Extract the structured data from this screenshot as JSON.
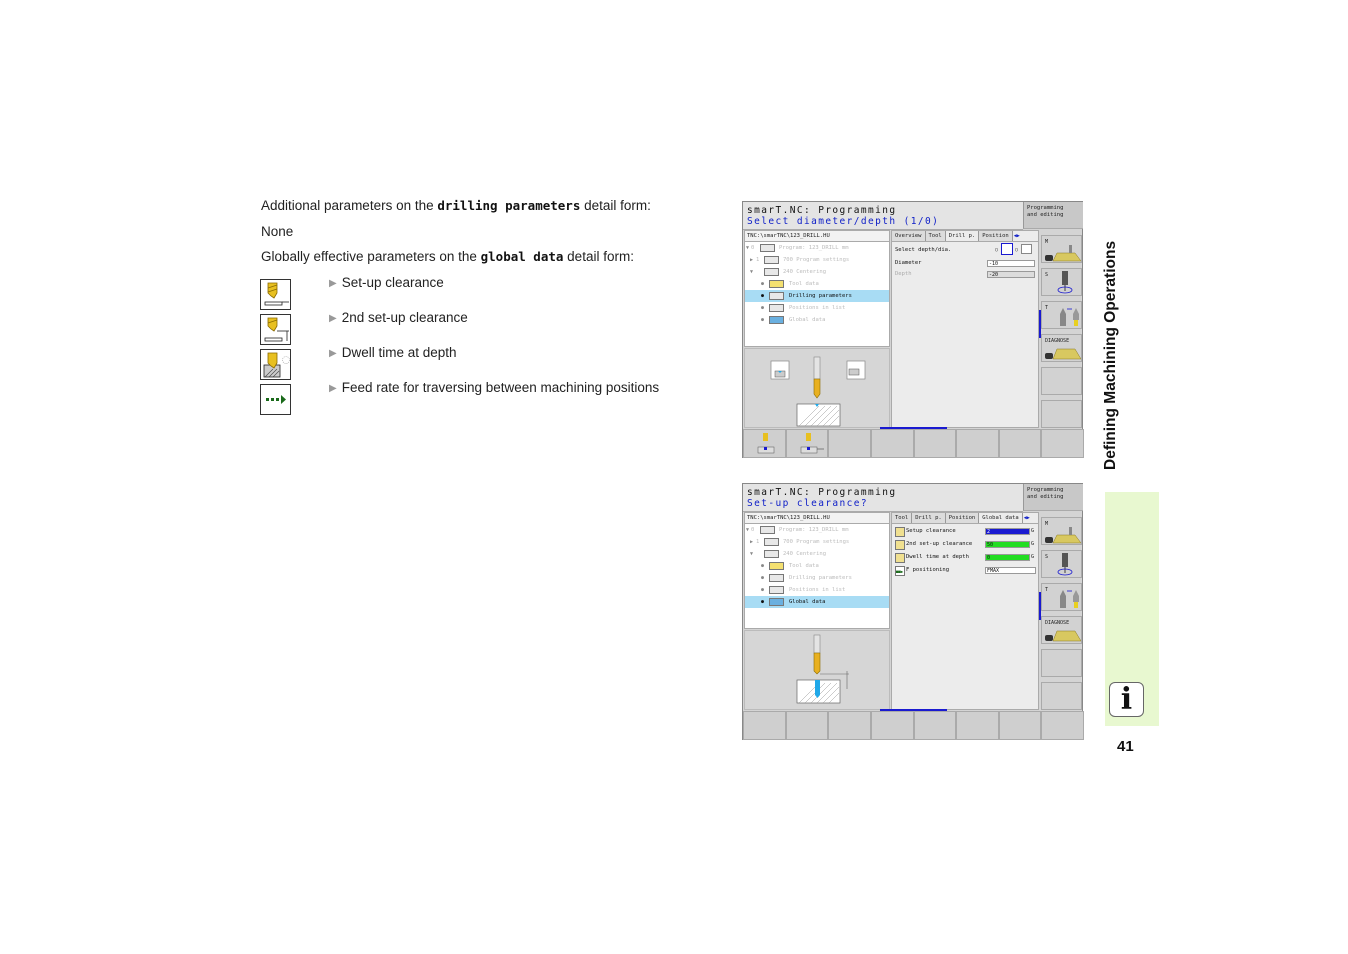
{
  "text": {
    "drilling_intro_before": "Additional parameters on the ",
    "drilling_intro_code": "drilling parameters",
    "drilling_intro_after": " detail form:",
    "none": "None",
    "global_intro_before": "Globally effective parameters on the ",
    "global_intro_code": "global data",
    "global_intro_after": " detail form:",
    "bullets": [
      {
        "label": "Set-up clearance",
        "icon": "setup-clearance-icon"
      },
      {
        "label": "2nd set-up clearance",
        "icon": "second-setup-clearance-icon"
      },
      {
        "label": "Dwell time at depth",
        "icon": "dwell-time-icon"
      },
      {
        "label": "Feed rate for traversing between machining positions",
        "icon": "feed-rate-icon"
      }
    ]
  },
  "screen1": {
    "title": "smarT.NC: Programming",
    "prompt": "Select diameter/depth (1/0)",
    "mode": [
      "Programming",
      "and editing"
    ],
    "path": "TNC:\\smarTNC\\123_DRILL.HU",
    "tree": [
      {
        "num": "0",
        "label": "Program: 123_DRILL mm",
        "selected": false
      },
      {
        "num": "1",
        "label": "700 Program settings",
        "selected": false
      },
      {
        "num": "",
        "label": "240 Centering",
        "selected": false
      },
      {
        "num": "",
        "label": "Tool data",
        "selected": false
      },
      {
        "num": "",
        "label": "Drilling parameters",
        "selected": true
      },
      {
        "num": "",
        "label": "Positions in list",
        "selected": false
      },
      {
        "num": "",
        "label": "Global data",
        "selected": false
      }
    ],
    "tabs": [
      "Overview",
      "Tool",
      "Drill p.",
      "Position"
    ],
    "active_tab": "Drill p.",
    "fields": [
      {
        "label": "Select depth/dia.",
        "value": ""
      },
      {
        "label": "Diameter",
        "value": "-10"
      },
      {
        "label": "Depth",
        "value": "-20"
      }
    ],
    "vertical_softkeys": [
      "M",
      "S",
      "T",
      "DIAGNOSE",
      "",
      ""
    ]
  },
  "screen2": {
    "title": "smarT.NC: Programming",
    "prompt": "Set-up clearance?",
    "mode": [
      "Programming",
      "and editing"
    ],
    "path": "TNC:\\smarTNC\\123_DRILL.HU",
    "tree": [
      {
        "num": "0",
        "label": "Program: 123_DRILL mm",
        "selected": false
      },
      {
        "num": "1",
        "label": "700 Program settings",
        "selected": false
      },
      {
        "num": "",
        "label": "240 Centering",
        "selected": false
      },
      {
        "num": "",
        "label": "Tool data",
        "selected": false
      },
      {
        "num": "",
        "label": "Drilling parameters",
        "selected": false
      },
      {
        "num": "",
        "label": "Positions in list",
        "selected": false
      },
      {
        "num": "",
        "label": "Global data",
        "selected": true
      }
    ],
    "tabs": [
      "Tool",
      "Drill p.",
      "Position",
      "Global data"
    ],
    "active_tab": "Global data",
    "fields": [
      {
        "label": "Setup clearance",
        "value": "2",
        "color": "#1a1ad0",
        "suffix": "G"
      },
      {
        "label": "2nd set-up clearance",
        "value": "50",
        "color": "#22dd22",
        "suffix": "G"
      },
      {
        "label": "Dwell time at depth",
        "value": "0",
        "color": "#22dd22",
        "suffix": "G"
      },
      {
        "label": "F positioning",
        "value": "FMAX",
        "color": "#ffffff",
        "suffix": ""
      }
    ],
    "vertical_softkeys": [
      "M",
      "S",
      "T",
      "DIAGNOSE",
      "",
      ""
    ]
  },
  "margin": {
    "chapter": "Defining Machining Operations",
    "info_glyph": "i",
    "page_number": "41"
  }
}
